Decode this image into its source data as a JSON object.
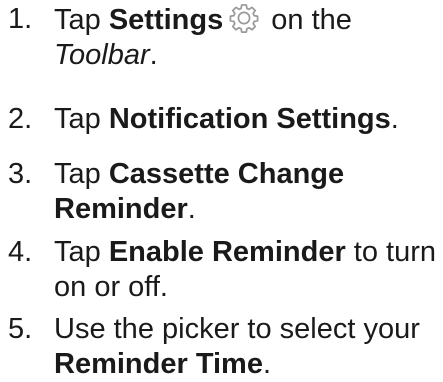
{
  "steps": [
    {
      "number": "1.",
      "t1": "Tap ",
      "bold": "Settings",
      "icon": "gear-icon",
      "t2": " on the",
      "italic": "Toolbar",
      "t3": "."
    },
    {
      "number": "2.",
      "t1": "Tap ",
      "bold": "Notification Settings",
      "t2": "."
    },
    {
      "number": "3.",
      "t1": "Tap ",
      "bold1": "Cassette Change",
      "bold2": "Reminder",
      "t2": "."
    },
    {
      "number": "4.",
      "t1": "Tap ",
      "bold": "Enable Reminder",
      "t2": " to turn",
      "t3": "on or off."
    },
    {
      "number": "5.",
      "t1": "Use the picker to select your",
      "bold": "Reminder Time",
      "t2": "."
    }
  ]
}
